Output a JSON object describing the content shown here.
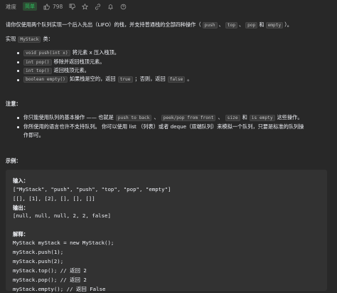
{
  "meta": {
    "difficulty_label": "难度",
    "difficulty": "简单",
    "likes": "798"
  },
  "intro": {
    "text": "请你仅使用两个队列实现一个后入先出（LIFO）的栈，并支持普通栈的全部四种操作（",
    "ops": [
      "push",
      "top",
      "pop",
      "empty"
    ],
    "sep": "、",
    "and": "和",
    "end": "）。"
  },
  "impl": {
    "prefix": "实现",
    "class_name": "MyStack",
    "suffix": "类："
  },
  "methods": [
    {
      "code": "void push(int x)",
      "desc": "将元素 x 压入栈顶。"
    },
    {
      "code": "int pop()",
      "desc": "移除并返回栈顶元素。"
    },
    {
      "code": "int top()",
      "desc": "返回栈顶元素。"
    },
    {
      "code": "boolean empty()",
      "desc_pre": "如果栈是空的，返回",
      "code2": "true",
      "desc_mid": "；否则，返回",
      "code3": "false",
      "desc_end": "。"
    }
  ],
  "notes": {
    "title": "注意：",
    "n1_pre": "你只能使用队列的基本操作 —— 也就是",
    "n1_codes": [
      "push to back",
      "peek/pop from front",
      "size",
      "is empty"
    ],
    "n1_and": "和",
    "n1_end": "这些操作。",
    "n2_line1": "你所使用的语言也许不支持队列。 你可以使用 list （列表）或者 deque（双端队列）来模拟一个队列，只要是标准的队列操",
    "n2_line2": "作即可。"
  },
  "example": {
    "title": "示例：",
    "input_label": "输入：",
    "input_line1": "[\"MyStack\", \"push\", \"push\", \"top\", \"pop\", \"empty\"]",
    "input_line2": "[[], [1], [2], [], [], []]",
    "output_label": "输出：",
    "output_line": "[null, null, null, 2, 2, false]",
    "explain_label": "解释：",
    "lines": [
      "MyStack myStack = new MyStack();",
      "myStack.push(1);",
      "myStack.push(2);",
      "myStack.top(); // 返回 2",
      "myStack.pop(); // 返回 2",
      "myStack.empty(); // 返回 False"
    ]
  }
}
